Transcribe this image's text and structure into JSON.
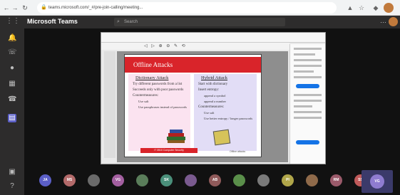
{
  "browser": {
    "url": "teams.microsoft.com/_#/pre-join-calling/meeting...",
    "nav_icons": [
      "back-arrow-icon",
      "forward-arrow-icon",
      "reload-icon"
    ]
  },
  "teams": {
    "app_title": "Microsoft Teams",
    "search_placeholder": "Search",
    "rail_icons": [
      "activity-icon",
      "chat-icon",
      "teams-icon",
      "calendar-icon",
      "calls-icon",
      "files-icon"
    ]
  },
  "slide": {
    "title": "Offline Attacks",
    "left_heading": "Dictionary Attack",
    "left_bullets": [
      "Try different passwords from a list",
      "Succeeds only with poor passwords",
      "Countermeasures:"
    ],
    "left_sub": [
      "Use salt",
      "Use passphrases instead of passwords"
    ],
    "right_heading": "Hybrid Attack",
    "right_bullets": [
      "Start with dictionary",
      "Insert entropy:",
      "Countermeasures:"
    ],
    "right_sub_a": [
      "append a symbol",
      "append a number"
    ],
    "right_sub_b": [
      "Use salt",
      "Use better entropy / longer passwords"
    ],
    "banner": "IT 3510 Computer Security",
    "footer": "Offline attacks"
  },
  "participants": [
    {
      "initials": "JA",
      "color": "#5b5fc7"
    },
    {
      "initials": "MS",
      "color": "#b36a6a"
    },
    {
      "initials": "",
      "color": "#6a6a6a"
    },
    {
      "initials": "VG",
      "color": "#a35fa0"
    },
    {
      "initials": "",
      "color": "#5a7d5a"
    },
    {
      "initials": "SK",
      "color": "#4a8f7a"
    },
    {
      "initials": "",
      "color": "#7a5a8f"
    },
    {
      "initials": "AB",
      "color": "#8f5a5a"
    },
    {
      "initials": "",
      "color": "#5a8f4a"
    },
    {
      "initials": "",
      "color": "#7a7a7a"
    },
    {
      "initials": "PI",
      "color": "#b0a64a"
    },
    {
      "initials": "",
      "color": "#8f6a4a"
    },
    {
      "initials": "RM",
      "color": "#9a5a6a"
    },
    {
      "initials": "SS",
      "color": "#c05a5a"
    }
  ],
  "self_view": {
    "initials": "VG"
  }
}
